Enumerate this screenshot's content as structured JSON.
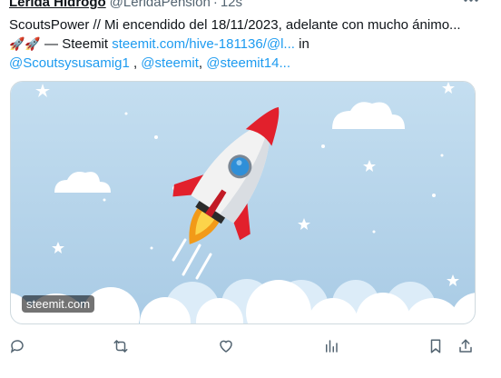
{
  "tweet": {
    "author_name": "Lerida Hidrogo",
    "author_handle": "@LeridaPension",
    "separator": "·",
    "time": "12s",
    "text_part1": "ScoutsPower // Mi encendido del  18/11/2023, adelante con mucho ánimo...",
    "emoji": "🚀🚀",
    "text_part2": " — Steemit ",
    "link_url": "steemit.com/hive-181136/@l...",
    "text_in": " in",
    "mention1": "@Scoutsysusamig1",
    "comma1": " , ",
    "mention2": "@steemit",
    "comma2": ", ",
    "mention3": "@steemit14..."
  },
  "media": {
    "domain_label": "steemit.com",
    "sky_color": "#b9d6ec",
    "cloud_color": "#ffffff",
    "rocket_body_color": "#f2f2f2",
    "rocket_fin_color": "#e2202c",
    "window_color": "#2f8fd8",
    "flame_color": "#f7a21b"
  },
  "actions": {
    "reply": "reply-icon",
    "retweet": "retweet-icon",
    "like": "heart-icon",
    "views": "views-icon",
    "bookmark": "bookmark-icon",
    "share": "share-icon"
  },
  "colors": {
    "link": "#1d9bf0",
    "secondary_text": "#536471",
    "icon": "#536471"
  }
}
